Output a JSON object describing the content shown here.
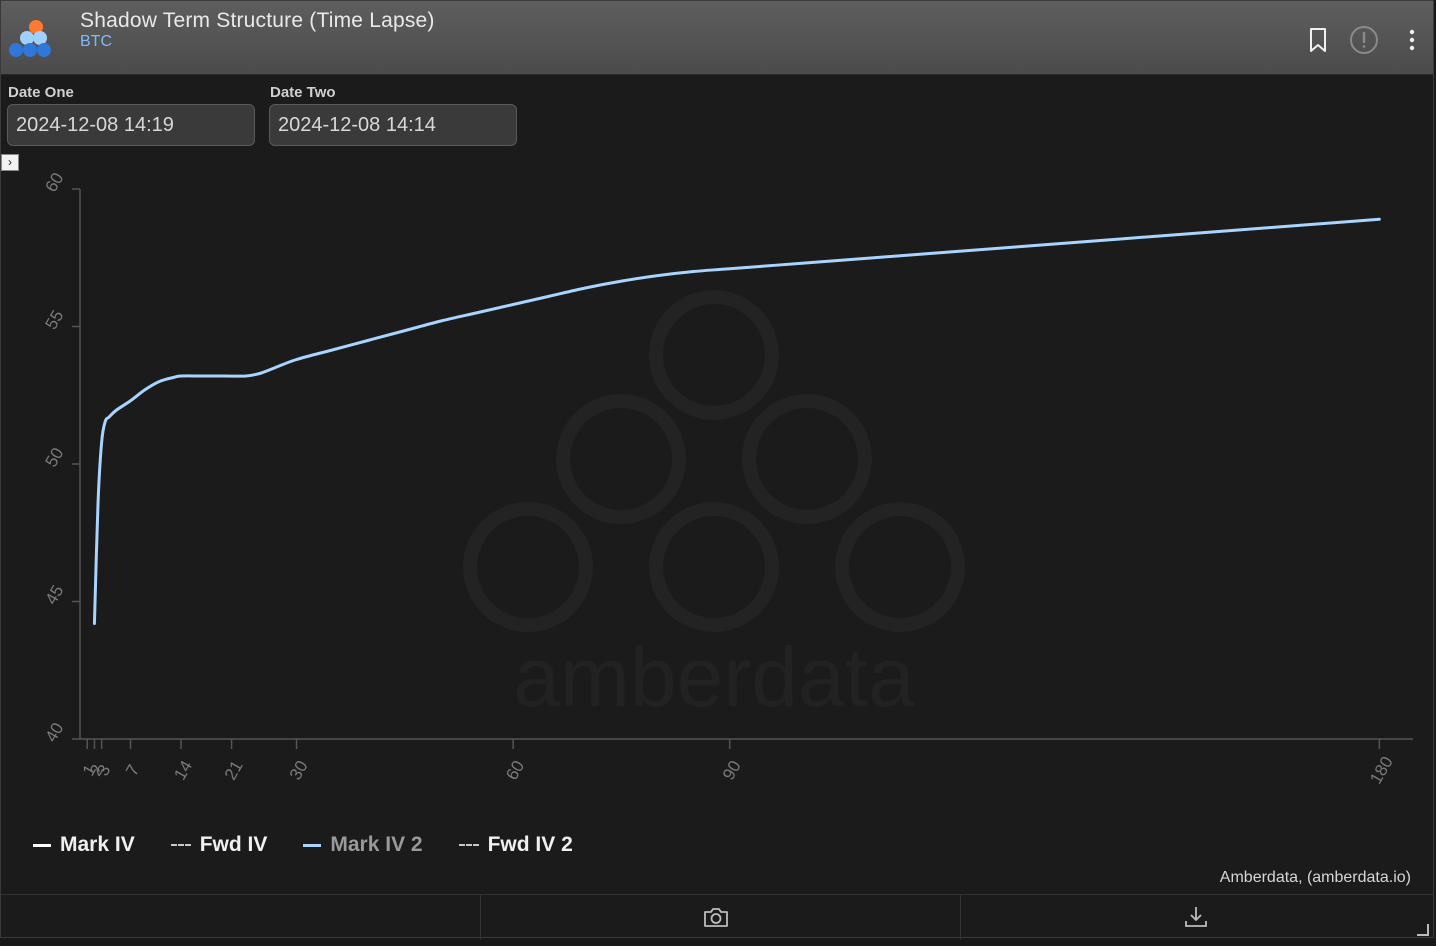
{
  "header": {
    "title": "Shadow Term Structure (Time Lapse)",
    "subtitle": "BTC",
    "icons": [
      "bookmark-icon",
      "alert-icon",
      "more-icon"
    ]
  },
  "filters": {
    "date_one_label": "Date One",
    "date_one_value": "2024-12-08 14:19",
    "date_two_label": "Date Two",
    "date_two_value": "2024-12-08 14:14"
  },
  "legend": [
    {
      "label": "Mark IV",
      "style": "solid",
      "color": "#ffffff"
    },
    {
      "label": "Fwd IV",
      "style": "dashed",
      "color": "#c8c8c8"
    },
    {
      "label": "Mark IV 2",
      "style": "solid",
      "color": "#a8d4ff"
    },
    {
      "label": "Fwd IV 2",
      "style": "dashed",
      "color": "#c8c8c8"
    }
  ],
  "credit": "Amberdata, (amberdata.io)",
  "watermark": "amberdata",
  "chart_data": {
    "type": "line",
    "xlabel": "",
    "ylabel": "",
    "ylim": [
      40,
      60
    ],
    "xlim": [
      0,
      183
    ],
    "y_ticks": [
      40,
      45,
      50,
      55,
      60
    ],
    "x_ticks": [
      1,
      2,
      3,
      7,
      14,
      21,
      30,
      60,
      90,
      180
    ],
    "grid": false,
    "legend_position": "bottom-left",
    "series": [
      {
        "name": "Mark IV 2",
        "color": "#a8d4ff",
        "x": [
          2,
          2.5,
          3,
          3.5,
          4,
          5,
          7,
          9,
          11,
          13,
          14,
          17,
          20,
          23,
          25,
          27,
          30,
          35,
          40,
          45,
          50,
          55,
          60,
          65,
          70,
          75,
          80,
          85,
          90,
          100,
          110,
          120,
          130,
          140,
          150,
          160,
          170,
          180
        ],
        "y": [
          44.2,
          48.6,
          50.8,
          51.55,
          51.7,
          51.95,
          52.3,
          52.7,
          53.0,
          53.15,
          53.2,
          53.2,
          53.2,
          53.2,
          53.3,
          53.5,
          53.8,
          54.15,
          54.5,
          54.85,
          55.2,
          55.5,
          55.8,
          56.1,
          56.4,
          56.65,
          56.85,
          57.0,
          57.1,
          57.3,
          57.5,
          57.7,
          57.9,
          58.1,
          58.3,
          58.5,
          58.7,
          58.9
        ]
      }
    ]
  }
}
